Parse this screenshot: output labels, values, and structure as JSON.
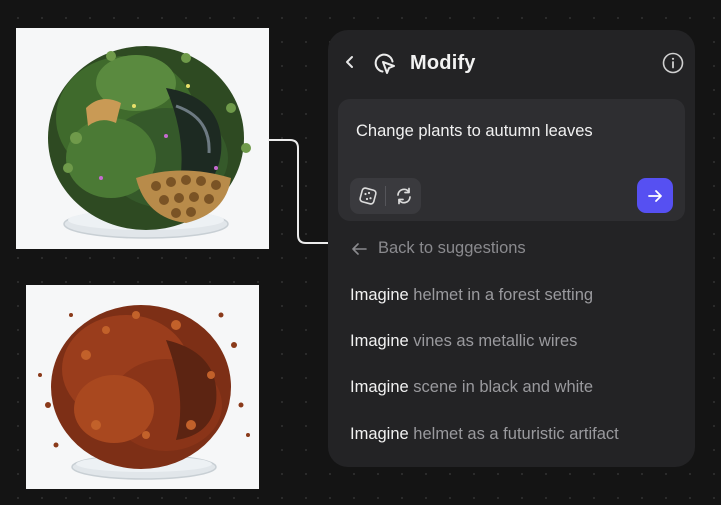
{
  "panel": {
    "title": "Modify",
    "prompt_text": "Change plants to autumn leaves",
    "back_link": "Back to suggestions",
    "suggestions": [
      {
        "keyword": "Imagine",
        "text": "helmet in a forest setting"
      },
      {
        "keyword": "Imagine",
        "text": "vines as metallic wires"
      },
      {
        "keyword": "Imagine",
        "text": "scene in black and white"
      },
      {
        "keyword": "Imagine",
        "text": "helmet as a futuristic artifact"
      }
    ]
  },
  "icons": {
    "back": "chevron-left-icon",
    "modify": "cursor-click-icon",
    "info": "info-icon",
    "dice": "dice-icon",
    "regenerate": "refresh-icon",
    "send": "arrow-right-icon",
    "back_link": "arrow-left-icon"
  },
  "colors": {
    "canvas": "#141414",
    "panel": "#232325",
    "prompt_box": "#2e2e31",
    "accent": "#5650f2",
    "muted_text": "#9a9a9e"
  }
}
